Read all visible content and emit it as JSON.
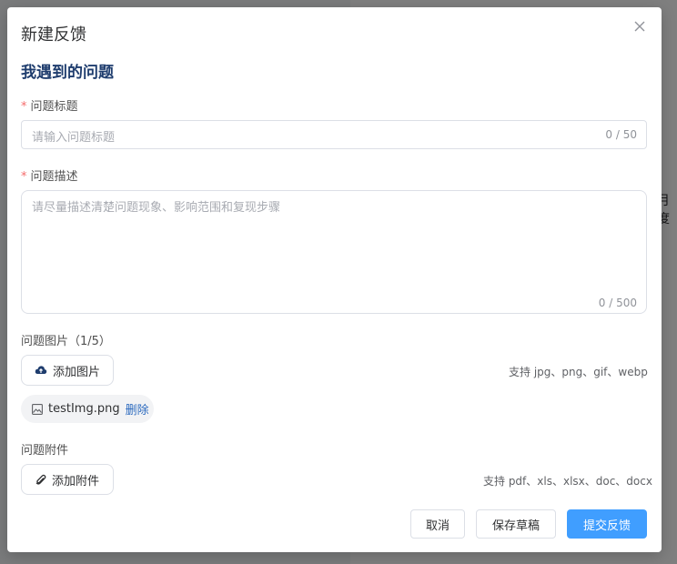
{
  "background": {
    "frag_right": "月度"
  },
  "dialog": {
    "title": "新建反馈",
    "section_title": "我遇到的问题",
    "title_field": {
      "required_mark": "*",
      "label": "问题标题",
      "placeholder": "请输入问题标题",
      "counter": "0 / 50"
    },
    "desc_field": {
      "required_mark": "*",
      "label": "问题描述",
      "placeholder": "请尽量描述清楚问题现象、影响范围和复现步骤",
      "counter": "0 / 500"
    },
    "images": {
      "label": "问题图片（1/5）",
      "add_label": "添加图片",
      "hint": "支持 jpg、png、gif、webp",
      "files": [
        {
          "name": "testImg.png",
          "delete_label": "删除"
        }
      ]
    },
    "attachments": {
      "label": "问题附件",
      "add_label": "添加附件",
      "hint": "支持 pdf、xls、xlsx、doc、docx"
    },
    "footer": {
      "cancel_label": "取消",
      "save_draft_label": "保存草稿",
      "submit_label": "提交反馈"
    },
    "colors": {
      "accent": "#409eff",
      "required": "#f56c6c",
      "link": "#2d6bbf",
      "section_title": "#1f3d6e"
    }
  }
}
